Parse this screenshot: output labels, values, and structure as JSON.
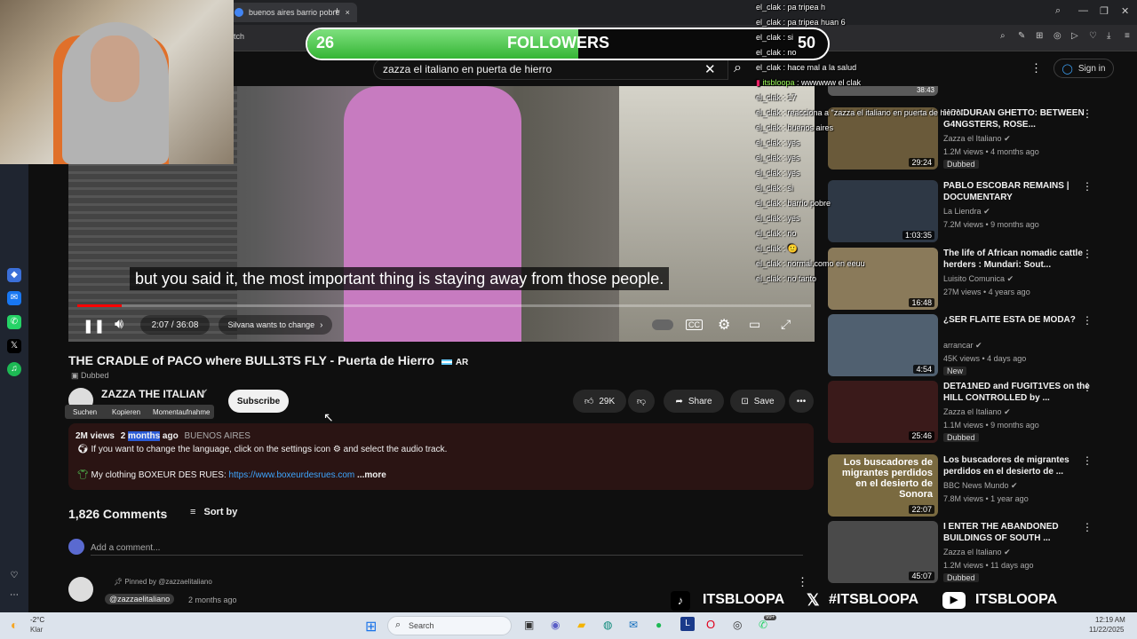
{
  "browser": {
    "tab_title": "buenos aires barrio pobre",
    "address_fragment": "tch"
  },
  "followers": {
    "current": "26",
    "label": "FOLLOWERS",
    "goal": "50",
    "progress_fraction": 0.52
  },
  "search": {
    "query": "zazza el italiano en puerta de hierro"
  },
  "youtube": {
    "sign_in": "Sign in",
    "subtitle": "but you said it, the most important thing is staying away from those people.",
    "time": "2:07 / 36:08",
    "progress_fraction": 0.06,
    "chapter_hint": "Silvana wants to change",
    "video_title": "THE CRADLE of PACO where BULL3TS FLY - Puerta de Hierro",
    "title_flag": "AR",
    "dubbed_label": "Dubbed",
    "channel_name": "ZAZZA THE ITALIAN",
    "subscribe_label": "Subscribe",
    "context_menu": [
      "Suchen",
      "Kopieren",
      "Momentaufnahme"
    ],
    "like_count": "29K",
    "share_label": "Share",
    "save_label": "Save",
    "description": {
      "views": "2M views",
      "date_prefix": "2",
      "date_highlight": "months",
      "date_suffix": " ago",
      "location": "BUENOS AIRES",
      "line1": "If you want to change the language, click on the settings icon",
      "line1_end": "and select the audio track.",
      "line2_prefix": "My clothing BOXEUR DES RUES:",
      "line2_link": "https://www.boxeurdesrues.com",
      "more_label": "...more"
    },
    "comments_count": "1,826 Comments",
    "sort_label": "Sort by",
    "add_comment_placeholder": "Add a comment...",
    "pinned_by": "Pinned by @zazzaelitaliano",
    "pinned_author": "@zazzaelitaliano",
    "pinned_time": "2 months ago"
  },
  "recommendations": [
    {
      "title": "HONDURAN GHETTO: BETWEEN G4NGSTERS, ROSE...",
      "channel": "Zazza el Italiano",
      "meta": "1.2M views • 4 months ago",
      "badge": "Dubbed",
      "duration": "29:24",
      "color": "#6a5a3a"
    },
    {
      "title": "PABLO ESCOBAR REMAINS | DOCUMENTARY",
      "channel": "La Liendra",
      "meta": "7.2M views • 9 months ago",
      "badge": "",
      "duration": "1:03:35",
      "color": "#2e3845"
    },
    {
      "title": "The life of African nomadic cattle herders : Mundari: Sout...",
      "channel": "Luisito Comunica",
      "meta": "27M views • 4 years ago",
      "badge": "",
      "duration": "16:48",
      "color": "#8a7a5a"
    },
    {
      "title": "¿SER FLAITE ESTA DE MODA?",
      "channel": "arrancar",
      "meta": "45K views • 4 days ago",
      "badge": "New",
      "duration": "4:54",
      "color": "#506070"
    },
    {
      "title": "DETA1NED and FUGIT1VES on the HILL CONTROLLED by ...",
      "channel": "Zazza el Italiano",
      "meta": "1.1M views • 9 months ago",
      "badge": "Dubbed",
      "duration": "25:46",
      "color": "#3a1a1a"
    },
    {
      "title": "Los buscadores de migrantes perdidos en el desierto de ...",
      "channel": "BBC News Mundo",
      "meta": "7.8M views • 1 year ago",
      "badge": "",
      "duration": "22:07",
      "color": "#7a6a40",
      "thumb_text": "Los buscadores de migrantes perdidos en el desierto de Sonora"
    },
    {
      "title": "I ENTER THE ABANDONED BUILDINGS OF SOUTH ...",
      "channel": "Zazza el Italiano",
      "meta": "1.2M views • 11 days ago",
      "badge": "Dubbed",
      "duration": "45:07",
      "color": "#4a4a4a"
    }
  ],
  "rec_top_partial": {
    "duration": "38:43"
  },
  "chat": [
    {
      "user": "el_clak",
      "msg": "pa tripea h"
    },
    {
      "user": "el_clak",
      "msg": "pa tripea huan 6"
    },
    {
      "user": "el_clak",
      "msg": "si"
    },
    {
      "user": "el_clak",
      "msg": "no"
    },
    {
      "user": "el_clak",
      "msg": "hace mal a la salud"
    },
    {
      "user": "itsbloopa",
      "msg": "wwwwww el clak"
    },
    {
      "user": "el_clak",
      "msg": "17"
    },
    {
      "user": "el_clak",
      "msg": "reacciona a \"zazza el italiano en puerta de hierro\""
    },
    {
      "user": "el_clak",
      "msg": "buenos aires"
    },
    {
      "user": "el_clak",
      "msg": "yes"
    },
    {
      "user": "el_clak",
      "msg": "yes"
    },
    {
      "user": "el_clak",
      "msg": "yes"
    },
    {
      "user": "el_clak",
      "msg": "si"
    },
    {
      "user": "el_clak",
      "msg": "barrio pobre"
    },
    {
      "user": "el_clak",
      "msg": "yes"
    },
    {
      "user": "el_clak",
      "msg": "no"
    },
    {
      "user": "el_clak",
      "msg": "🙂"
    },
    {
      "user": "el_clak",
      "msg": "normal,como en eeuu"
    },
    {
      "user": "el_clak",
      "msg": "no tanto"
    }
  ],
  "banner": {
    "handle1": "ITSBLOOPA",
    "handle2": "#ITSBLOOPA",
    "handle3": "ITSBLOOPA"
  },
  "taskbar": {
    "weather_temp": "-2°C",
    "weather_desc": "Klar",
    "search_placeholder": "Search",
    "time": "12:19 AM",
    "date": "11/22/2025",
    "badge": "99+"
  }
}
